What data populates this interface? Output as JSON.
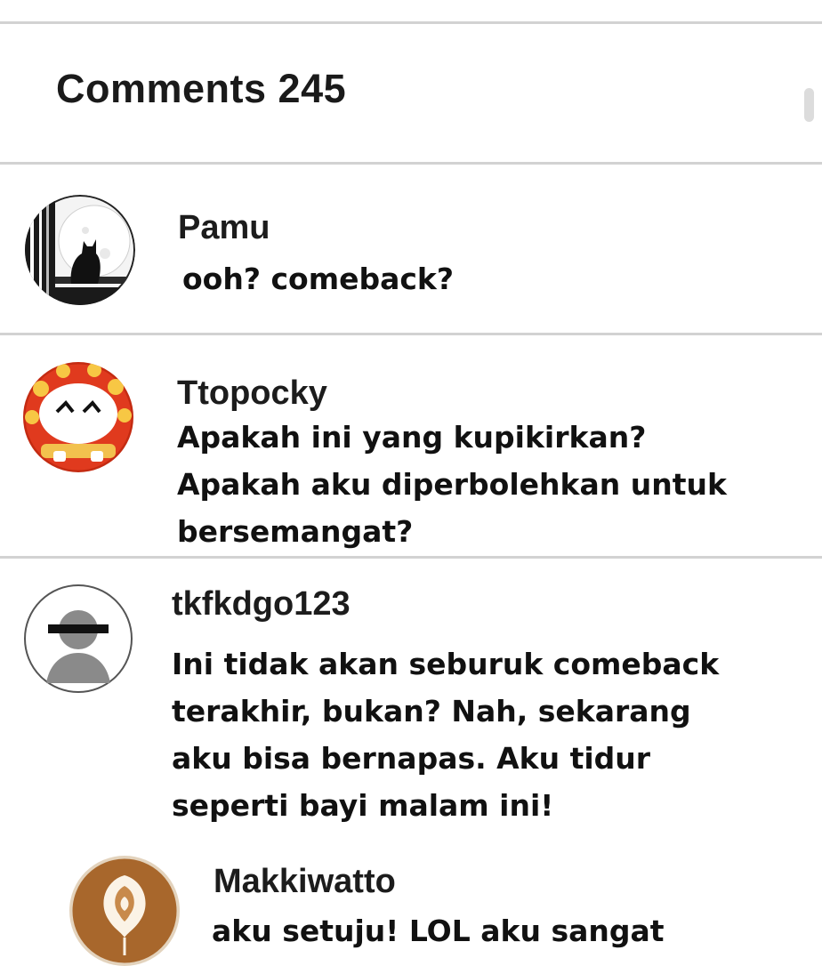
{
  "header": {
    "title": "Comments 245"
  },
  "comments": [
    {
      "username": "Pamu",
      "avatar": "cat-moon-avatar",
      "lines": [
        "ooh? comeback?"
      ]
    },
    {
      "username": "Ttopocky",
      "avatar": "cake-face-avatar",
      "lines": [
        "Apakah ini yang kupikirkan?",
        "Apakah aku diperbolehkan untuk",
        "bersemangat?"
      ]
    },
    {
      "username": "tkfkdgo123",
      "avatar": "default-user-avatar",
      "lines": [
        "Ini tidak akan seburuk comeback",
        "terakhir, bukan? Nah, sekarang",
        "aku bisa bernapas. Aku tidur",
        "seperti bayi malam ini!"
      ]
    },
    {
      "username": "Makkiwatto",
      "avatar": "latte-art-avatar",
      "lines": [
        "aku setuju! LOL aku sangat"
      ]
    }
  ]
}
